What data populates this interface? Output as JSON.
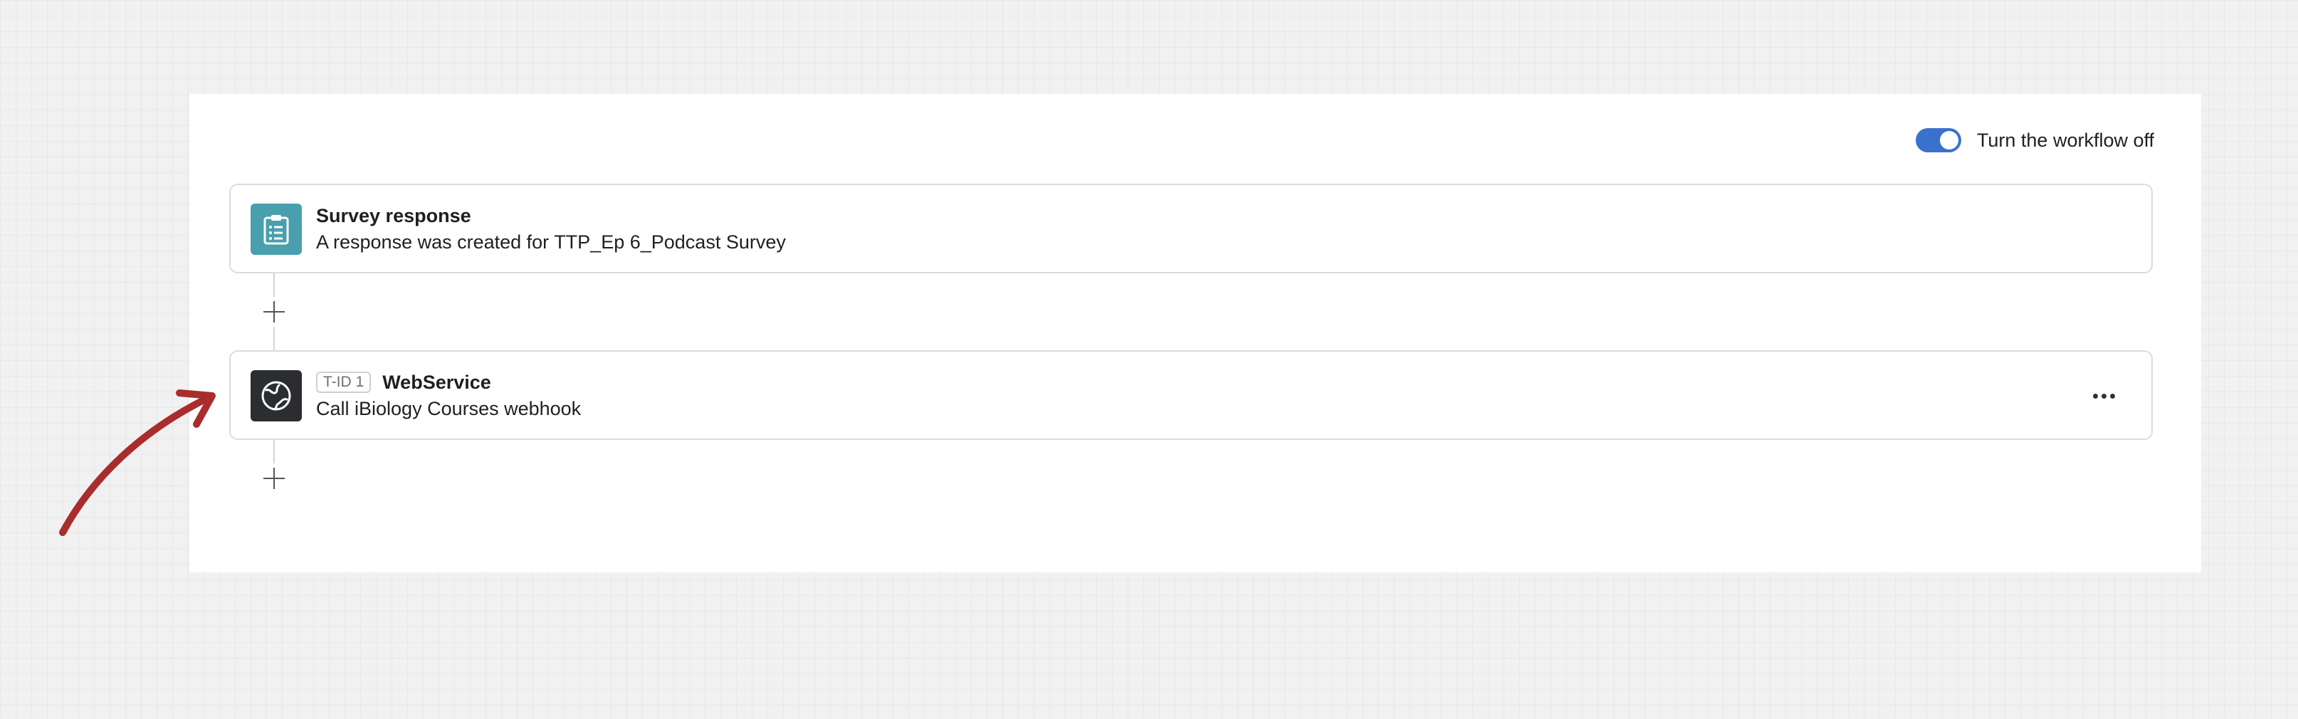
{
  "colors": {
    "toggle_on": "#3a71cc",
    "trigger_icon_bg": "#4a9fae",
    "task_icon_bg": "#2b2d30",
    "annotation_arrow": "#a92d2d"
  },
  "workflow": {
    "toggle": {
      "state": "on",
      "label": "Turn the workflow off"
    },
    "trigger": {
      "icon": "clipboard-list-icon",
      "title": "Survey response",
      "description": "A response was created for TTP_Ep 6_Podcast Survey"
    },
    "tasks": [
      {
        "icon": "globe-icon",
        "badge": "T-ID 1",
        "title": "WebService",
        "description": "Call iBiology Courses webhook",
        "menu_icon": "more-horizontal-icon"
      }
    ],
    "add_step_icon": "plus-icon"
  },
  "annotation": {
    "icon": "curved-arrow-icon"
  }
}
